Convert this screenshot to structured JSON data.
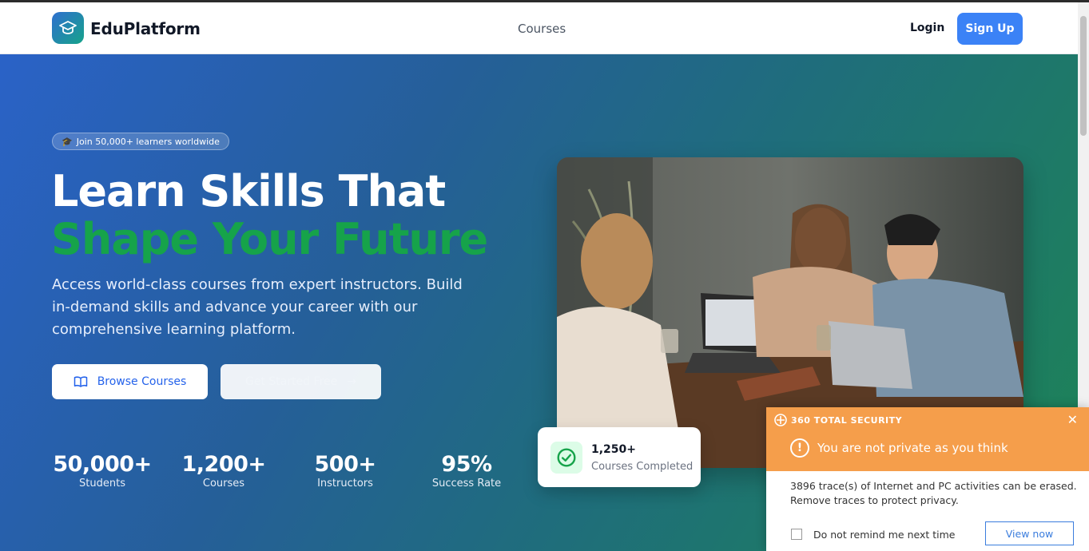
{
  "nav": {
    "brand": "EduPlatform",
    "links": [
      "Courses"
    ],
    "login": "Login",
    "signup": "Sign Up"
  },
  "hero": {
    "badge": "Join 50,000+ learners worldwide",
    "headline_line1": "Learn Skills That",
    "headline_line2": "Shape Your Future",
    "subtitle": "Access world-class courses from expert instructors. Build in-demand skills and advance your career with our comprehensive learning platform.",
    "browse_button": "Browse Courses",
    "start_button": "Get Started Free",
    "stats": [
      {
        "value": "50,000+",
        "label": "Students"
      },
      {
        "value": "1,200+",
        "label": "Courses"
      },
      {
        "value": "500+",
        "label": "Instructors"
      },
      {
        "value": "95%",
        "label": "Success Rate"
      }
    ]
  },
  "floating_card": {
    "value": "1,250+",
    "label": "Courses Completed"
  },
  "popup": {
    "brand": "360 TOTAL SECURITY",
    "title": "You are not private as you think",
    "message": "3896 trace(s) of Internet and PC activities can be erased. Remove traces to protect privacy.",
    "checkbox_label": "Do not remind me next time",
    "view_button": "View now"
  },
  "colors": {
    "accent_blue": "#3b82f6",
    "headline_green": "#16a34a",
    "popup_orange": "#f59e4b"
  }
}
